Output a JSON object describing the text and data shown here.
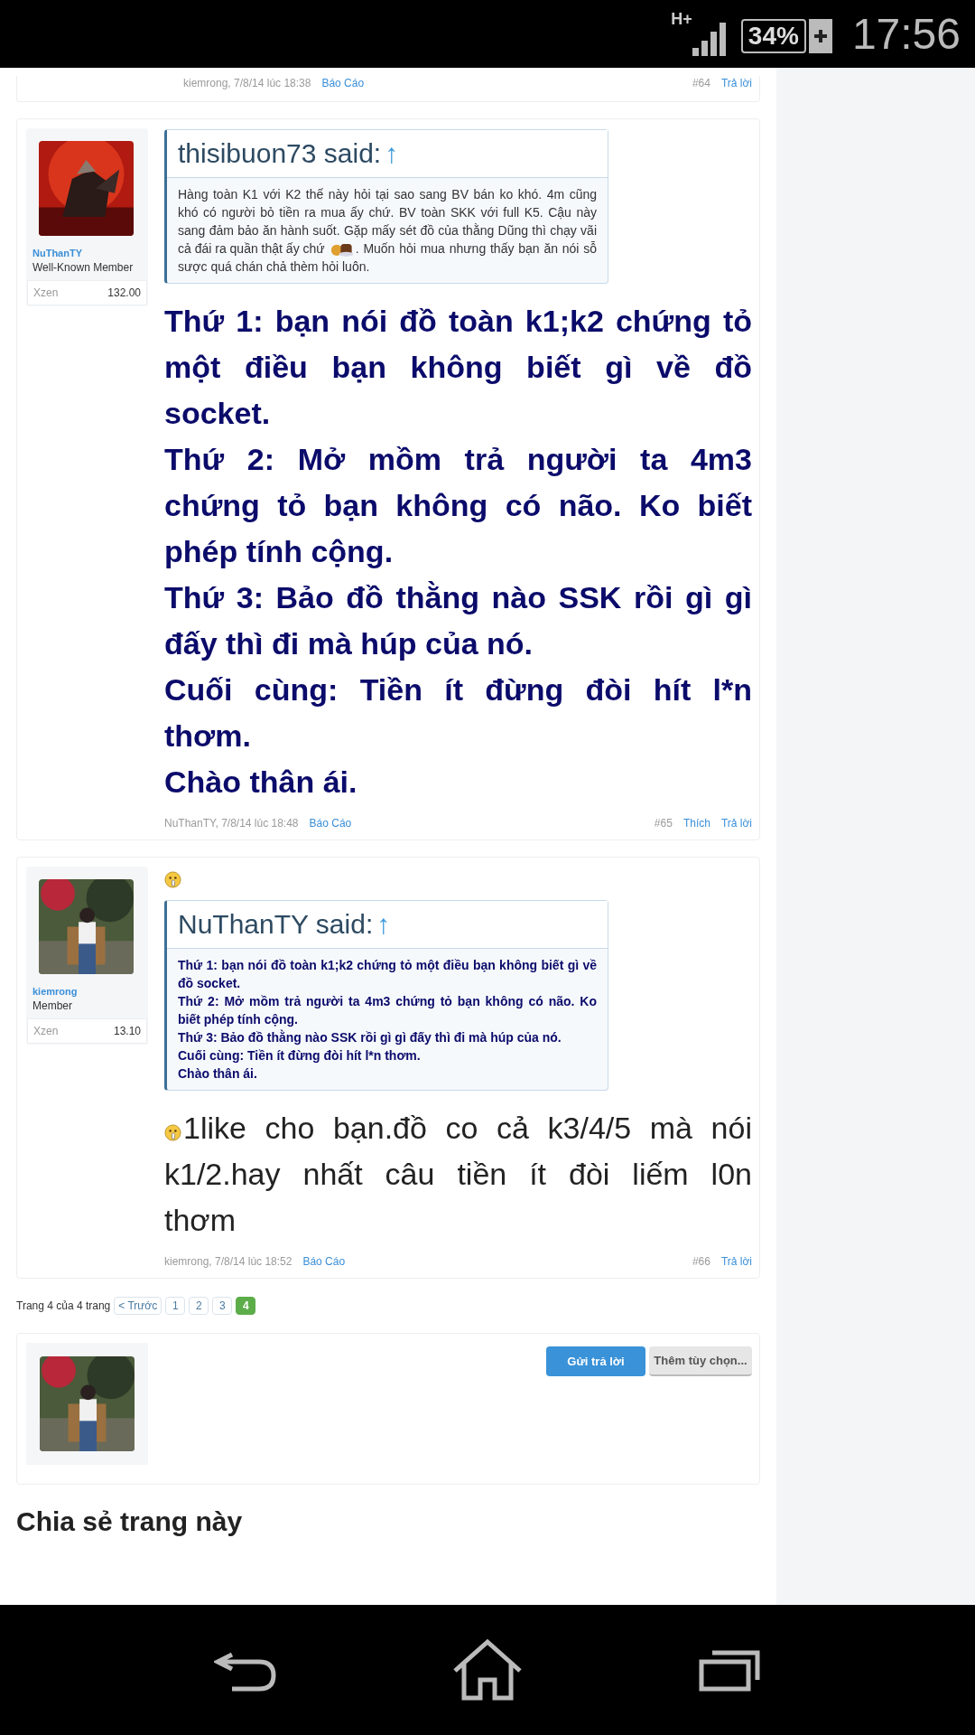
{
  "status_bar": {
    "network": "H+",
    "battery": "34%",
    "time": "17:56"
  },
  "posts": [
    {
      "footer": {
        "author_date": "kiemrong, 7/8/14 lúc 18:38",
        "report": "Báo Cáo",
        "number": "#64",
        "reply": "Trả lời"
      }
    },
    {
      "user": {
        "name": "NuThanTY",
        "title": "Well-Known Member",
        "stat_label": "Xzen",
        "stat_value": "132.00"
      },
      "blocks": [
        {
          "kind": "quote",
          "author": "thisibuon73 said:",
          "arrow": "↑",
          "bold": false,
          "content": [
            {
              "kind": "full_line",
              "text": "Hàng toàn K1 với K2 thế này hỏi tại sao sang BV bán ko khó. 4m cũng"
            },
            {
              "kind": "full_line",
              "text": "khó có người bỏ tiền ra mua ấy chứ. BV toàn SKK với full K5. Cậu này"
            },
            {
              "kind": "full_line",
              "text": "sang đảm bảo ăn hành suốt. Gặp mấy sét đồ của thằng Dũng thì chạy vãi"
            },
            {
              "kind": "emoji_line",
              "before": "cả đái ra quần thật ấy chứ",
              "after": ". Muốn hỏi mua nhưng thấy bạn ăn nói sỗ"
            },
            {
              "kind": "line",
              "text": "sược quá chán chả thèm hỏi luôn."
            }
          ]
        },
        {
          "kind": "big_bold",
          "lines": [
            "Thứ 1: bạn nói đồ toàn k1;k2 chứng tỏ một điều bạn không biết gì về đồ socket.",
            "Thứ 2: Mở mồm trả người ta 4m3 chứng tỏ bạn không có não. Ko biết phép tính cộng.",
            "Thứ 3: Bảo đồ thằng nào SSK rồi gì gì đấy thì đi mà húp của nó.",
            "Cuối cùng: Tiền ít đừng đòi hít l*n thơm.",
            "Chào thân ái."
          ]
        }
      ],
      "footer": {
        "author_date": "NuThanTY, 7/8/14 lúc 18:48",
        "report": "Báo Cáo",
        "number": "#65",
        "like": "Thích",
        "reply": "Trả lời"
      }
    },
    {
      "user": {
        "name": "kiemrong",
        "title": "Member",
        "stat_label": "Xzen",
        "stat_value": "13.10"
      },
      "blocks": [
        {
          "kind": "smiley"
        },
        {
          "kind": "quote",
          "author": "NuThanTY said:",
          "arrow": "↑",
          "bold": true,
          "content": [
            {
              "kind": "line",
              "text": "Thứ 1: bạn nói đồ toàn k1;k2 chứng tỏ một điều bạn không biết gì về đồ socket."
            },
            {
              "kind": "line",
              "text": "Thứ 2: Mở mồm trả người ta 4m3 chứng tỏ bạn không có não. Ko biết phép tính cộng."
            },
            {
              "kind": "line",
              "text": "Thứ 3: Bảo đồ thằng nào SSK rồi gì gì đấy thì đi mà húp của nó."
            },
            {
              "kind": "line",
              "text": "Cuối cùng: Tiền ít đừng đòi hít l*n thơm."
            },
            {
              "kind": "line",
              "text": "Chào thân ái."
            }
          ]
        },
        {
          "kind": "paragraph",
          "content": [
            {
              "kind": "smiley_line",
              "text": "1like cho bạn.đồ co cả k3/4/5 mà nói"
            },
            {
              "kind": "full_line",
              "text": "k1/2.hay nhất câu tiền ít đòi liếm l0n"
            },
            {
              "kind": "line",
              "text": "thơm"
            }
          ]
        }
      ],
      "footer": {
        "author_date": "kiemrong, 7/8/14 lúc 18:52",
        "report": "Báo Cáo",
        "number": "#66",
        "reply": "Trả lời"
      }
    }
  ],
  "pagination": {
    "label": "Trang 4 của 4 trang",
    "prev": "< Trước",
    "pages": [
      {
        "label": "1",
        "selected": false
      },
      {
        "label": "2",
        "selected": false
      },
      {
        "label": "3",
        "selected": false
      },
      {
        "label": "4",
        "selected": true
      }
    ]
  },
  "reply_box": {
    "submit": "Gửi trả lời",
    "more": "Thêm tùy chọn..."
  },
  "share_heading": "Chia sẻ trang này"
}
